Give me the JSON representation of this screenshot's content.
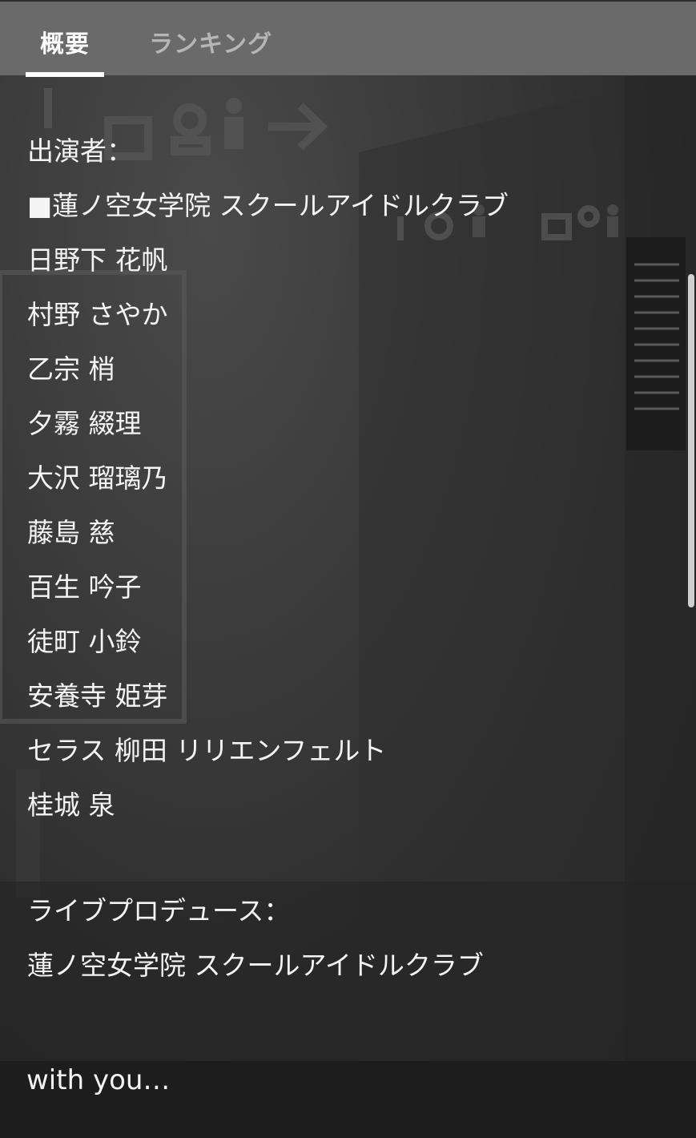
{
  "tabs": {
    "overview": "概要",
    "ranking": "ランキング"
  },
  "description": {
    "performers_heading": "出演者：",
    "group": "■蓮ノ空女学院 スクールアイドルクラブ",
    "performers": [
      "日野下 花帆",
      "村野 さやか",
      "乙宗 梢",
      "夕霧 綴理",
      "大沢 瑠璃乃",
      "藤島 慈",
      "百生 吟子",
      "徒町 小鈴",
      "安養寺 姫芽",
      "セラス 柳田 リリエンフェルト",
      "桂城 泉"
    ],
    "producer_heading": "ライブプロデュース：",
    "producer": "蓮ノ空女学院 スクールアイドルクラブ"
  },
  "footer": {
    "title": "with you…"
  },
  "colors": {
    "tabbar_bg": "#6a6a6a",
    "active_tab": "#ffffff",
    "inactive_tab": "#b6b6b6",
    "text": "#f4f4f4",
    "footer_bg": "#1d1d1d"
  }
}
